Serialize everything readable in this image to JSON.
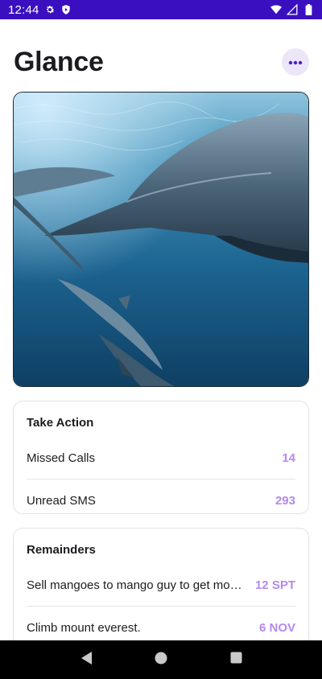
{
  "status_bar": {
    "time": "12:44",
    "background": "#3a0fc0",
    "left_icons": [
      "gear-icon",
      "shield-play-icon"
    ],
    "right_icons": [
      "wifi-icon",
      "signal-icon",
      "battery-icon"
    ]
  },
  "header": {
    "title": "Glance",
    "more_icon": "more-horizontal-icon"
  },
  "hero": {
    "subject": "dolphins-underwater-photo"
  },
  "take_action": {
    "title": "Take Action",
    "rows": [
      {
        "label": "Missed Calls",
        "value": "14"
      },
      {
        "label": "Unread SMS",
        "value": "293"
      }
    ]
  },
  "reminders": {
    "title": "Remainders",
    "rows": [
      {
        "label": "Sell mangoes to mango guy to get mo…",
        "value": "12 SPT"
      },
      {
        "label": "Climb mount everest.",
        "value": "6 NOV"
      }
    ]
  },
  "nav_bar": {
    "buttons": [
      "back-icon",
      "home-icon",
      "recents-icon"
    ]
  },
  "colors": {
    "accent": "#b588ef",
    "status_bar": "#3a0fc0",
    "more_button_bg": "#ece6f8",
    "more_dots": "#4a1fd0"
  }
}
